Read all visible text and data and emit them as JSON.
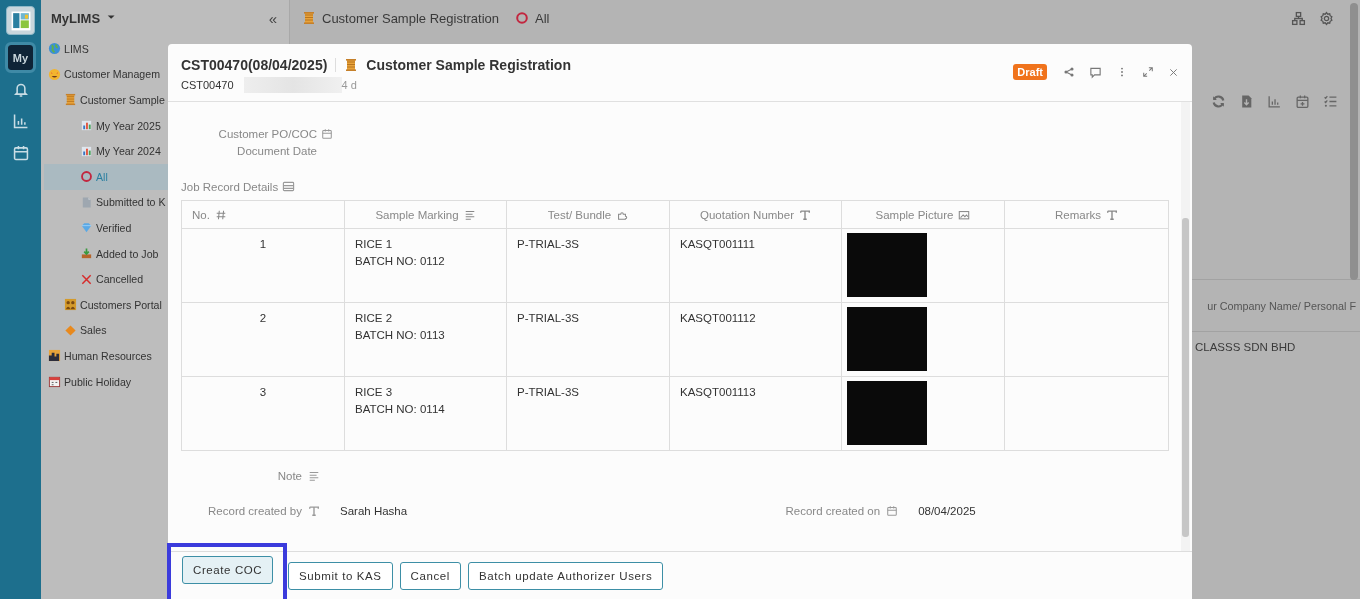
{
  "rail": {
    "badge": "My"
  },
  "sidebar": {
    "title": "MyLIMS",
    "collapse": "«",
    "items": [
      {
        "label": "LIMS",
        "selected": false
      },
      {
        "label": "Customer Managem",
        "selected": false,
        "children": [
          {
            "label": "Customer Sample",
            "selected": false,
            "children": [
              {
                "label": "My Year 2025",
                "selected": false
              },
              {
                "label": "My Year 2024",
                "selected": false
              },
              {
                "label": "All",
                "selected": true
              },
              {
                "label": "Submitted to K",
                "selected": false
              },
              {
                "label": "Verified",
                "selected": false
              },
              {
                "label": "Added to Job",
                "selected": false
              },
              {
                "label": "Cancelled",
                "selected": false
              }
            ]
          },
          {
            "label": "Customers Portal",
            "selected": false
          },
          {
            "label": "Sales",
            "selected": false
          }
        ]
      },
      {
        "label": "Human Resources",
        "selected": false
      },
      {
        "label": "Public Holiday",
        "selected": false
      }
    ]
  },
  "main": {
    "breadcrumb": [
      "Customer Sample Registration",
      "All"
    ],
    "table": {
      "column": "ur Company Name/ Personal F",
      "cell": "CLASSS SDN BHD"
    }
  },
  "dialog": {
    "title": "CST00470(08/04/2025)",
    "form": "Customer Sample Registration",
    "record_id": "CST00470",
    "age": "4 d",
    "status": "Draft",
    "fields": [
      {
        "label": "Customer PO/COC"
      },
      {
        "label": "Document Date"
      }
    ],
    "section": "Job Record Details",
    "columns": [
      "No.",
      "Sample Marking",
      "Test/ Bundle",
      "Quotation Number",
      "Sample Picture",
      "Remarks"
    ],
    "rows": [
      {
        "no": "1",
        "marking": [
          "RICE 1",
          "BATCH NO: 0112"
        ],
        "test": "P-TRIAL-3S",
        "quotation": "KASQT001111",
        "picture": {
          "kind": "picture"
        }
      },
      {
        "no": "2",
        "marking": [
          "RICE 2",
          "BATCH NO: 0113"
        ],
        "test": "P-TRIAL-3S",
        "quotation": "KASQT001112",
        "picture": {
          "kind": "picture"
        }
      },
      {
        "no": "3",
        "marking": [
          "RICE 3",
          "BATCH NO: 0114"
        ],
        "test": "P-TRIAL-3S",
        "quotation": "KASQT001113",
        "picture": {
          "kind": "picture"
        }
      }
    ],
    "note": {
      "label": "Note"
    },
    "created_by": {
      "label": "Record created by",
      "value": "Sarah Hasha"
    },
    "created_on": {
      "label": "Record created on",
      "value": "08/04/2025"
    },
    "buttons": [
      {
        "label": "Create COC",
        "highlighted": true
      },
      {
        "label": "Submit to KAS",
        "highlighted": false
      },
      {
        "label": "Cancel",
        "highlighted": false
      },
      {
        "label": "Batch update Authorizer Users",
        "highlighted": false
      }
    ]
  }
}
